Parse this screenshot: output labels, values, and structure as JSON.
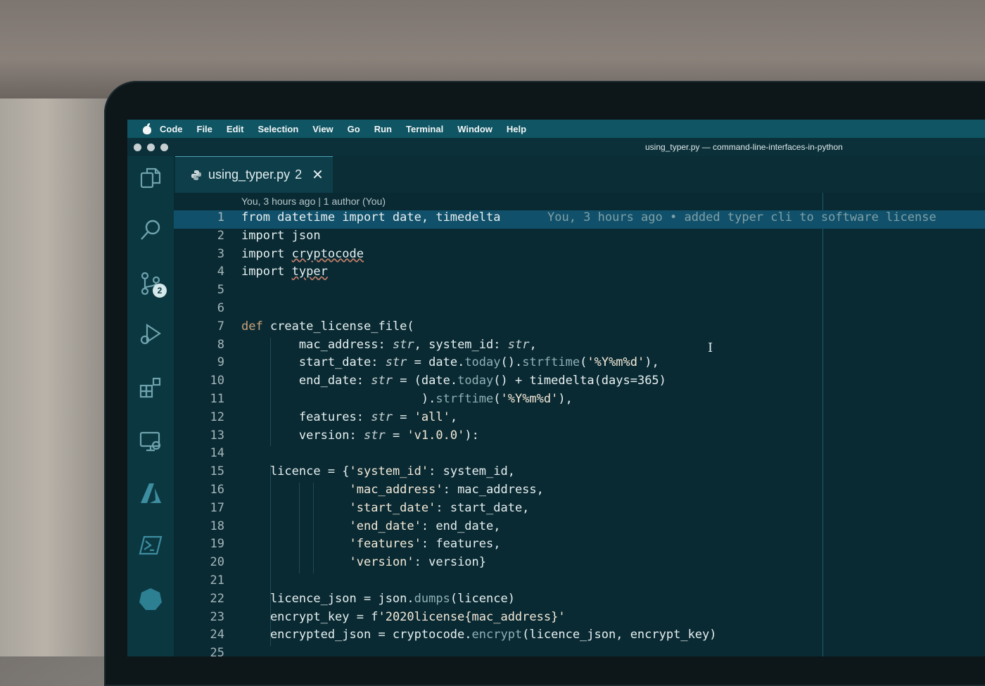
{
  "menubar": {
    "items": [
      "Code",
      "File",
      "Edit",
      "Selection",
      "View",
      "Go",
      "Run",
      "Terminal",
      "Window",
      "Help"
    ]
  },
  "titlebar": {
    "title": "using_typer.py — command-line-interfaces-in-python"
  },
  "activity_bar": {
    "icons": [
      "explorer-icon",
      "search-icon",
      "source-control-icon",
      "run-debug-icon",
      "extensions-icon",
      "remote-explorer-icon",
      "azure-icon",
      "powershell-icon",
      "kubernetes-icon"
    ],
    "source_control_badge": "2"
  },
  "tab": {
    "filename": "using_typer.py",
    "problems": "2",
    "close": "✕"
  },
  "editor": {
    "codelens": "You, 3 hours ago | 1 author (You)",
    "blame": "You, 3 hours ago • added typer cli to software license",
    "line_numbers": [
      "1",
      "2",
      "3",
      "4",
      "5",
      "6",
      "7",
      "8",
      "9",
      "10",
      "11",
      "12",
      "13",
      "14",
      "15",
      "16",
      "17",
      "18",
      "19",
      "20",
      "21",
      "22",
      "23",
      "24",
      "25"
    ],
    "lines": [
      "from datetime import date, timedelta",
      "import json",
      "import cryptocode",
      "import typer",
      "",
      "",
      "def create_license_file(",
      "        mac_address: str, system_id: str,",
      "        start_date: str = date.today().strftime('%Y%m%d'),",
      "        end_date: str = (date.today() + timedelta(days=365)",
      "                         ).strftime('%Y%m%d'),",
      "        features: str = 'all',",
      "        version: str = 'v1.0.0'):",
      "",
      "    licence = {'system_id': system_id,",
      "               'mac_address': mac_address,",
      "               'start_date': start_date,",
      "               'end_date': end_date,",
      "               'features': features,",
      "               'version': version}",
      "",
      "    licence_json = json.dumps(licence)",
      "    encrypt_key = f'2020license{mac_address}'",
      "    encrypted_json = cryptocode.encrypt(licence_json, encrypt_key)",
      ""
    ]
  },
  "colors": {
    "menubar": "#0f5563",
    "activity_bar": "#0b3741",
    "editor_bg": "#0a2a33",
    "active_line": "#11506a"
  }
}
